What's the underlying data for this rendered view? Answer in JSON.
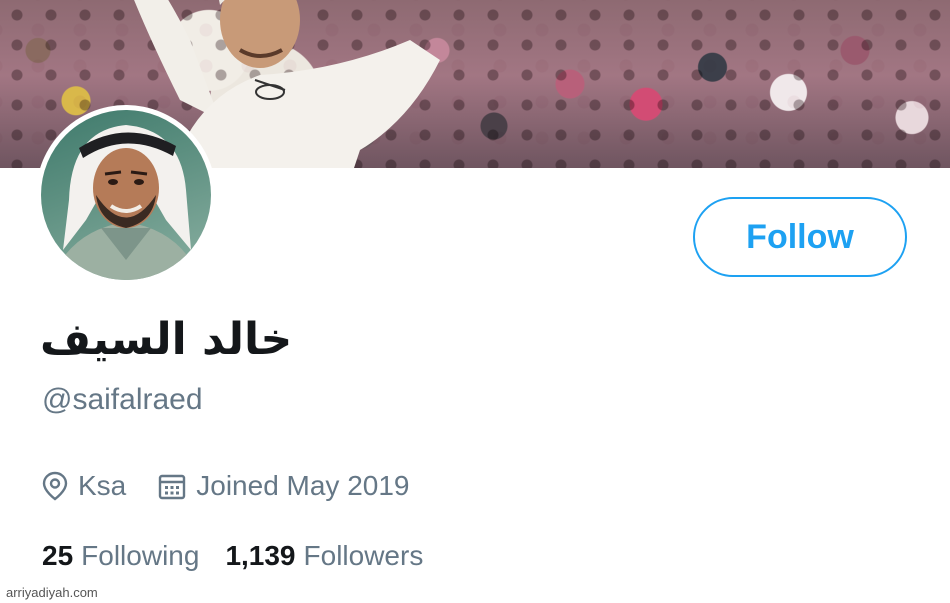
{
  "profile": {
    "display_name": "خالد السيف",
    "handle": "@saifalraed",
    "location": "Ksa",
    "joined": "Joined May 2019"
  },
  "follow_button": {
    "label": "Follow"
  },
  "stats": {
    "following_count": "25",
    "following_label": "Following",
    "followers_count": "1,139",
    "followers_label": "Followers"
  },
  "watermark": "arriyadiyah.com",
  "icons": {
    "location": "location-pin-icon",
    "calendar": "calendar-icon"
  },
  "colors": {
    "accent": "#1da1f2",
    "secondary_text": "#657786",
    "primary_text": "#14171a"
  }
}
